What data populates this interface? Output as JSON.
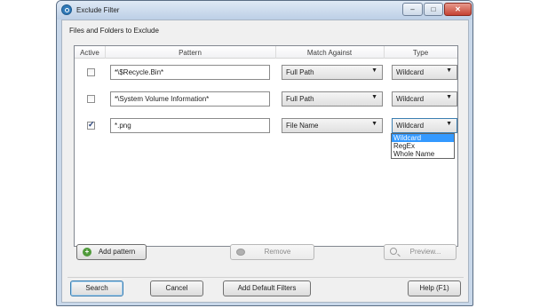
{
  "window": {
    "title": "Exclude Filter"
  },
  "section": {
    "label": "Files and Folders to Exclude"
  },
  "table": {
    "headers": {
      "active": "Active",
      "pattern": "Pattern",
      "match": "Match Against",
      "type": "Type"
    },
    "rows": [
      {
        "active": false,
        "pattern": "*\\$Recycle.Bin*",
        "match": "Full Path",
        "type": "Wildcard"
      },
      {
        "active": false,
        "pattern": "*\\System Volume Information*",
        "match": "Full Path",
        "type": "Wildcard"
      },
      {
        "active": true,
        "pattern": "*.png",
        "match": "File Name",
        "type": "Wildcard"
      }
    ]
  },
  "type_dropdown": {
    "options": [
      "Wildcard",
      "RegEx",
      "Whole Name"
    ],
    "selected": "Wildcard"
  },
  "actions": {
    "add": "Add pattern",
    "remove": "Remove",
    "preview": "Preview..."
  },
  "footer": {
    "search": "Search",
    "cancel": "Cancel",
    "add_default": "Add Default Filters",
    "help": "Help (F1)"
  },
  "icons": {
    "add": "add-icon",
    "remove": "remove-icon",
    "preview": "magnifier-icon"
  }
}
